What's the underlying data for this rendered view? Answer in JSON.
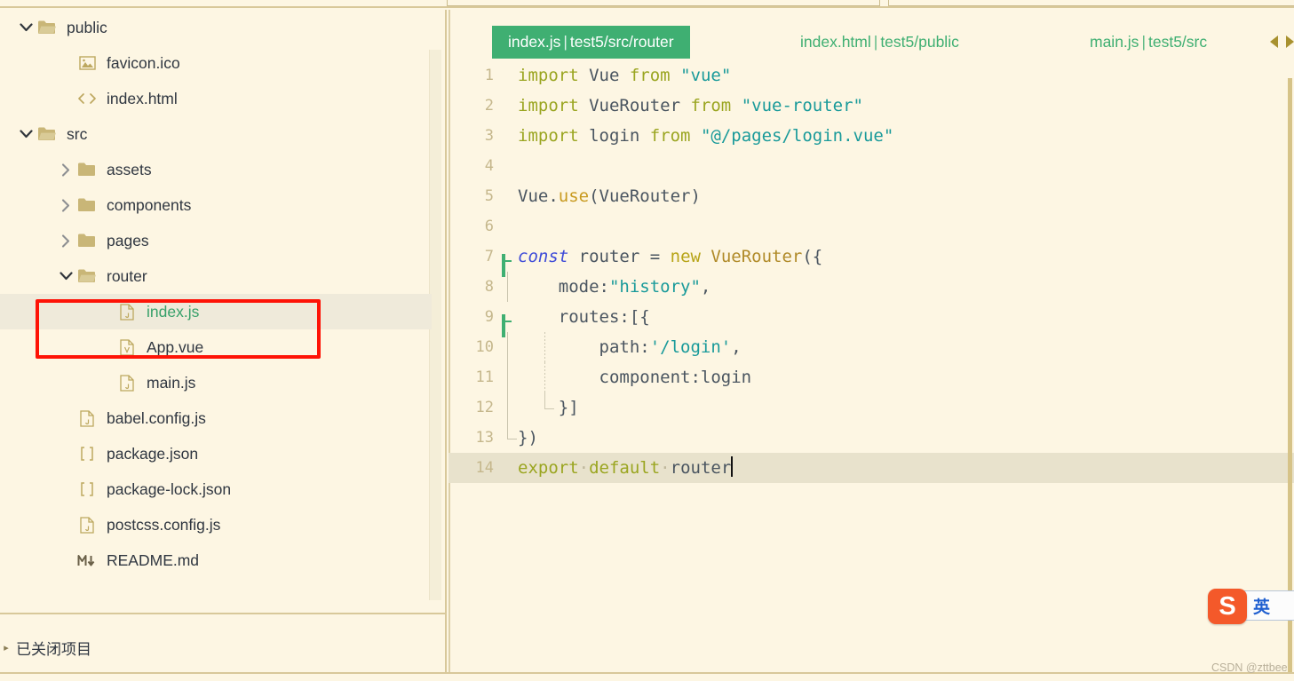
{
  "window": {
    "background_color": "#fdf6e3",
    "border_color": "#d8c89a"
  },
  "sidebar": {
    "scrollbar": "vertical-scrollbar",
    "tree": [
      {
        "label": "public",
        "icon": "folder-open-icon",
        "twisty": "chevron-down-icon",
        "indent": 0,
        "selected": false,
        "color": "default"
      },
      {
        "label": "favicon.ico",
        "icon": "image-file-icon",
        "twisty": "none",
        "indent": 1,
        "selected": false,
        "color": "default"
      },
      {
        "label": "index.html",
        "icon": "html-file-icon",
        "twisty": "none",
        "indent": 1,
        "selected": false,
        "color": "default"
      },
      {
        "label": "src",
        "icon": "folder-open-icon",
        "twisty": "chevron-down-icon",
        "indent": 0,
        "selected": false,
        "color": "default"
      },
      {
        "label": "assets",
        "icon": "folder-icon",
        "twisty": "chevron-right-icon",
        "indent": 1,
        "selected": false,
        "color": "default"
      },
      {
        "label": "components",
        "icon": "folder-icon",
        "twisty": "chevron-right-icon",
        "indent": 1,
        "selected": false,
        "color": "default"
      },
      {
        "label": "pages",
        "icon": "folder-icon",
        "twisty": "chevron-right-icon",
        "indent": 1,
        "selected": false,
        "color": "default"
      },
      {
        "label": "router",
        "icon": "folder-open-icon",
        "twisty": "chevron-down-icon",
        "indent": 1,
        "selected": false,
        "color": "default"
      },
      {
        "label": "index.js",
        "icon": "js-file-icon",
        "twisty": "none",
        "indent": 2,
        "selected": true,
        "color": "green"
      },
      {
        "label": "App.vue",
        "icon": "vue-file-icon",
        "twisty": "none",
        "indent": 2,
        "selected": false,
        "color": "default"
      },
      {
        "label": "main.js",
        "icon": "js-file-icon",
        "twisty": "none",
        "indent": 2,
        "selected": false,
        "color": "default"
      },
      {
        "label": "babel.config.js",
        "icon": "js-file-icon",
        "twisty": "none",
        "indent": 1,
        "selected": false,
        "color": "default"
      },
      {
        "label": "package.json",
        "icon": "json-file-icon",
        "twisty": "none",
        "indent": 1,
        "selected": false,
        "color": "default"
      },
      {
        "label": "package-lock.json",
        "icon": "json-file-icon",
        "twisty": "none",
        "indent": 1,
        "selected": false,
        "color": "default"
      },
      {
        "label": "postcss.config.js",
        "icon": "js-file-icon",
        "twisty": "none",
        "indent": 1,
        "selected": false,
        "color": "default"
      },
      {
        "label": "README.md",
        "icon": "markdown-file-icon",
        "twisty": "none",
        "indent": 1,
        "selected": false,
        "color": "default"
      }
    ]
  },
  "closed_projects_panel": {
    "label": "已关闭项目",
    "arrow_icon": "chevron-right-icon"
  },
  "annotation": {
    "red_box_color": "#fe1306",
    "highlights": [
      "router",
      "index.js"
    ]
  },
  "editor": {
    "tabs": [
      {
        "name": "index.js",
        "path": "test5/src/router",
        "active": true
      },
      {
        "name": "index.html",
        "path": "test5/public",
        "active": false
      },
      {
        "name": "main.js",
        "path": "test5/src",
        "active": false
      }
    ],
    "tab_separator": "|",
    "tab_active_color": "#3faf72",
    "scroll_left_icon": "triangle-left-icon",
    "scroll_right_icon": "triangle-right-icon",
    "current_line": 14,
    "lines": [
      {
        "no": "1",
        "fold": "none",
        "guide": "none",
        "tokens": [
          {
            "t": "import",
            "c": "kw"
          },
          {
            "t": " Vue ",
            "c": "plain"
          },
          {
            "t": "from",
            "c": "kw"
          },
          {
            "t": " ",
            "c": "plain"
          },
          {
            "t": "\"vue\"",
            "c": "str"
          }
        ]
      },
      {
        "no": "2",
        "fold": "none",
        "guide": "none",
        "tokens": [
          {
            "t": "import",
            "c": "kw"
          },
          {
            "t": " VueRouter ",
            "c": "plain"
          },
          {
            "t": "from",
            "c": "kw"
          },
          {
            "t": " ",
            "c": "plain"
          },
          {
            "t": "\"vue-router\"",
            "c": "str"
          }
        ]
      },
      {
        "no": "3",
        "fold": "none",
        "guide": "none",
        "tokens": [
          {
            "t": "import",
            "c": "kw"
          },
          {
            "t": " login ",
            "c": "plain"
          },
          {
            "t": "from",
            "c": "kw"
          },
          {
            "t": " ",
            "c": "plain"
          },
          {
            "t": "\"@/pages/login.vue\"",
            "c": "str"
          }
        ]
      },
      {
        "no": "4",
        "fold": "none",
        "guide": "none",
        "tokens": []
      },
      {
        "no": "5",
        "fold": "none",
        "guide": "none",
        "tokens": [
          {
            "t": "Vue.",
            "c": "plain"
          },
          {
            "t": "use",
            "c": "fn"
          },
          {
            "t": "(VueRouter)",
            "c": "plain"
          }
        ]
      },
      {
        "no": "6",
        "fold": "none",
        "guide": "none",
        "tokens": []
      },
      {
        "no": "7",
        "fold": "collapse",
        "guide": "none",
        "tokens": [
          {
            "t": "const",
            "c": "const"
          },
          {
            "t": " router ",
            "c": "plain"
          },
          {
            "t": "=",
            "c": "op"
          },
          {
            "t": " ",
            "c": "plain"
          },
          {
            "t": "new",
            "c": "kw2"
          },
          {
            "t": " ",
            "c": "plain"
          },
          {
            "t": "VueRouter",
            "c": "cls"
          },
          {
            "t": "({",
            "c": "plain"
          }
        ]
      },
      {
        "no": "8",
        "fold": "none",
        "guide": "line",
        "tokens": [
          {
            "t": "    mode:",
            "c": "plain"
          },
          {
            "t": "\"history\"",
            "c": "str"
          },
          {
            "t": ",",
            "c": "plain"
          }
        ]
      },
      {
        "no": "9",
        "fold": "collapse",
        "guide": "none",
        "tokens": [
          {
            "t": "    routes:[{",
            "c": "plain"
          }
        ]
      },
      {
        "no": "10",
        "fold": "none",
        "guide": "both",
        "tokens": [
          {
            "t": "        path:",
            "c": "plain"
          },
          {
            "t": "'/login'",
            "c": "str"
          },
          {
            "t": ",",
            "c": "plain"
          }
        ]
      },
      {
        "no": "11",
        "fold": "none",
        "guide": "both",
        "tokens": [
          {
            "t": "        component:login",
            "c": "plain"
          }
        ]
      },
      {
        "no": "12",
        "fold": "none",
        "guide": "end2",
        "tokens": [
          {
            "t": "    }]",
            "c": "plain"
          }
        ]
      },
      {
        "no": "13",
        "fold": "none",
        "guide": "end",
        "tokens": [
          {
            "t": "})",
            "c": "plain"
          }
        ]
      },
      {
        "no": "14",
        "fold": "none",
        "guide": "none",
        "current": true,
        "tokens": [
          {
            "t": "export",
            "c": "kw"
          },
          {
            "t": "·",
            "c": "ws"
          },
          {
            "t": "default",
            "c": "kw"
          },
          {
            "t": "·",
            "c": "ws"
          },
          {
            "t": "router",
            "c": "plain"
          }
        ]
      }
    ]
  },
  "ime": {
    "logo_letter": "S",
    "language": "英",
    "logo_color": "#f4592a"
  },
  "watermark": {
    "text": "CSDN @zttbee"
  }
}
